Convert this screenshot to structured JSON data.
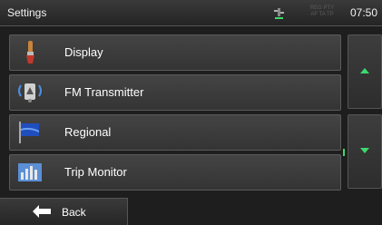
{
  "header": {
    "title": "Settings",
    "rds": "REG PTY AF TA TP",
    "time": "07:50"
  },
  "menu": {
    "items": [
      {
        "label": "Display",
        "icon": "paintbrush-icon"
      },
      {
        "label": "FM Transmitter",
        "icon": "fm-transmitter-icon"
      },
      {
        "label": "Regional",
        "icon": "flag-icon"
      },
      {
        "label": "Trip Monitor",
        "icon": "trip-monitor-icon"
      }
    ]
  },
  "footer": {
    "back_label": "Back"
  },
  "colors": {
    "accent": "#3dd86e"
  }
}
